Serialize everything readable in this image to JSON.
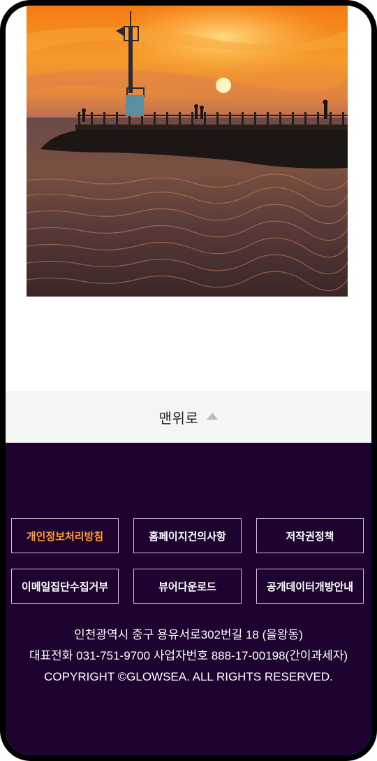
{
  "scroll_top": {
    "label": "맨위로",
    "icon": "triangle-up-icon"
  },
  "footer": {
    "links": [
      {
        "label": "개인정보처리방침",
        "active": true
      },
      {
        "label": "홈페이지건의사항",
        "active": false
      },
      {
        "label": "저작권정책",
        "active": false
      },
      {
        "label": "이메일집단수집거부",
        "active": false
      },
      {
        "label": "뷰어다운로드",
        "active": false
      },
      {
        "label": "공개데이터개방안내",
        "active": false
      }
    ],
    "address": "인천광역시 중구 용유서로302번길 18 (을왕동)",
    "contact": "대표전화 031-751-9700 사업자번호 888-17-00198(간이과세자)",
    "copyright": "COPYRIGHT ©GLOWSEA. ALL RIGHTS RESERVED."
  },
  "colors": {
    "footer_bg": "#1e0330",
    "active_link": "#ff9f2e",
    "top_bar_bg": "#f5f5f5"
  }
}
